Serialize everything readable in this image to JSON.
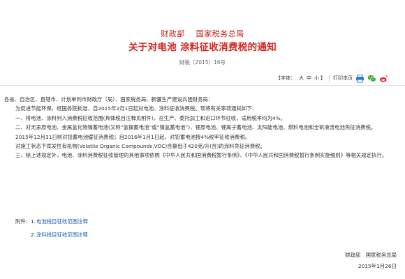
{
  "header": {
    "agency_1": "财政部",
    "agency_2": "国家税务总局",
    "title": "关于对电池 涂料征收消费税的通知",
    "doc_number": "财税〔2015〕16号"
  },
  "toolbar": {
    "font_label": "【字体：",
    "size_large": "大",
    "size_medium": "中",
    "size_small": "小",
    "font_close": "】",
    "print_label": "打印本页",
    "icons": [
      "print-icon",
      "wechat-icon",
      "weibo-icon"
    ],
    "colors": {
      "wechat": "#3eb135",
      "weibo": "#e6162d",
      "print": "#2c7ad6"
    }
  },
  "body": {
    "salutation": "各省、自治区、直辖市、计划单列市财政厅（局）、国家税务局、新疆生产建设兵团财务局：",
    "paragraphs": [
      "为促进节能环保，经国务院批准，自2015年2月1日起对电池、涂料征收消费税。现将有关事项通知如下：",
      "一、将电池、涂料列入消费税征收范围(具体税目注释见附件)，在生产、委托加工和进口环节征收，适用税率均为4%。",
      "二、对无汞原电池、金属氢化物镍蓄电池(又称“氢镍蓄电池”或“镍氢蓄电池”)、锂原电池、锂离子蓄电池、太阳能电池、燃料电池和全钒液流电池免征消费税。",
      "2015年12月31日前对铅蓄电池缓征消费税；自2016年1月1日起，对铅蓄电池按4%税率征收消费税。",
      "对施工状态下挥发性有机物(Volatile Organic Compounds,VOC)含量低于420克/升(含)的涂料免征消费税。",
      "三、除上述规定外，电池、涂料消费税征收管理的其他事项依照《中华人民共和国消费税暂行条例》、《中华人民共和国消费税暂行条例实施细则》等相关规定执行。"
    ]
  },
  "attachments": {
    "label": "附件：",
    "items": [
      {
        "num": "1.",
        "text": "电池税目征收范围注释"
      },
      {
        "num": "2.",
        "text": "涂料税目征收范围注释"
      }
    ]
  },
  "signature": {
    "issuers": "财政部　国家税务总局",
    "date": "2015年1月26日"
  },
  "accent_colors": {
    "title": "#d4221d",
    "agency": "#c41a16",
    "link": "#1a5ea8"
  }
}
